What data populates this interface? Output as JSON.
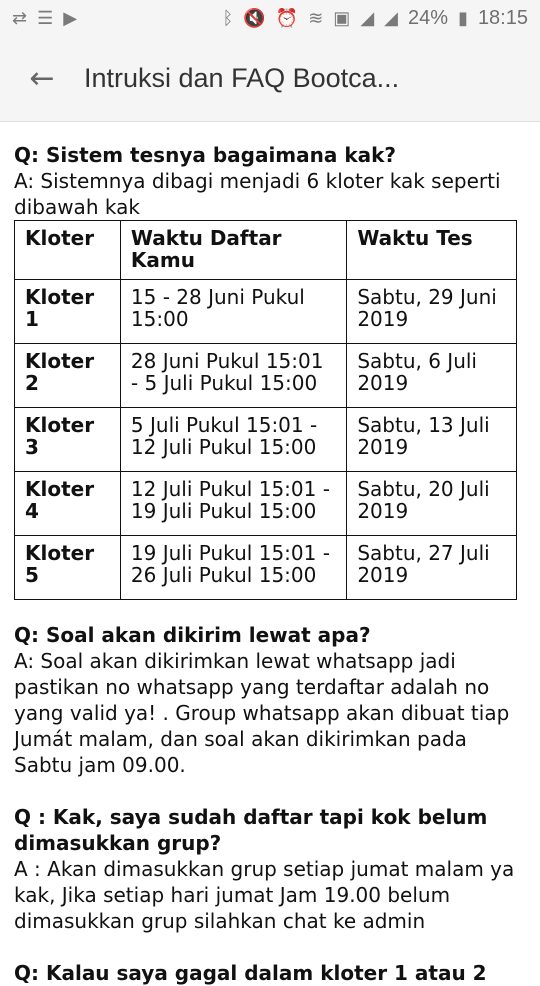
{
  "status": {
    "battery": "24%",
    "time": "18:15",
    "icons_left": [
      "usb-icon",
      "list-icon",
      "play-store-icon"
    ],
    "icons_right": [
      "bluetooth-icon",
      "mute-icon",
      "alarm-icon",
      "wifi-icon",
      "sim-icon",
      "signal-icon",
      "signal-icon",
      "battery-icon"
    ]
  },
  "appbar": {
    "title": "Intruksi dan FAQ Bootca..."
  },
  "sections": [
    {
      "q": "Q: Sistem tesnya bagaimana kak?",
      "a": "A: Sistemnya dibagi menjadi 6 kloter kak seperti dibawah kak"
    },
    {
      "q": "Q: Soal akan dikirim lewat apa?",
      "a": "A: Soal akan dikirimkan lewat whatsapp jadi pastikan no whatsapp yang terdaftar adalah no yang valid ya! . Group whatsapp akan dibuat tiap Jumát malam, dan soal akan dikirimkan pada Sabtu jam 09.00."
    },
    {
      "q": "Q : Kak, saya sudah daftar tapi kok belum dimasukkan grup?",
      "a": "A : Akan dimasukkan grup setiap jumat malam ya kak, Jika setiap hari jumat Jam 19.00 belum dimasukkan grup silahkan chat ke admin"
    },
    {
      "q": "Q: Kalau saya gagal dalam kloter 1 atau 2"
    }
  ],
  "table": {
    "headers": [
      "Kloter",
      "Waktu Daftar Kamu",
      "Waktu Tes"
    ],
    "rows": [
      [
        "Kloter 1",
        "15 - 28  Juni Pukul 15:00",
        "Sabtu, 29 Juni 2019"
      ],
      [
        "Kloter 2",
        "28 Juni Pukul 15:01 - 5 Juli Pukul 15:00",
        "Sabtu, 6 Juli 2019"
      ],
      [
        "Kloter 3",
        "5 Juli Pukul 15:01 - 12 Juli Pukul 15:00",
        "Sabtu, 13 Juli 2019"
      ],
      [
        "Kloter 4",
        "12 Juli Pukul 15:01 - 19 Juli Pukul 15:00",
        "Sabtu, 20 Juli 2019"
      ],
      [
        "Kloter 5",
        "19 Juli Pukul 15:01 - 26 Juli Pukul 15:00",
        "Sabtu, 27 Juli 2019"
      ]
    ]
  }
}
